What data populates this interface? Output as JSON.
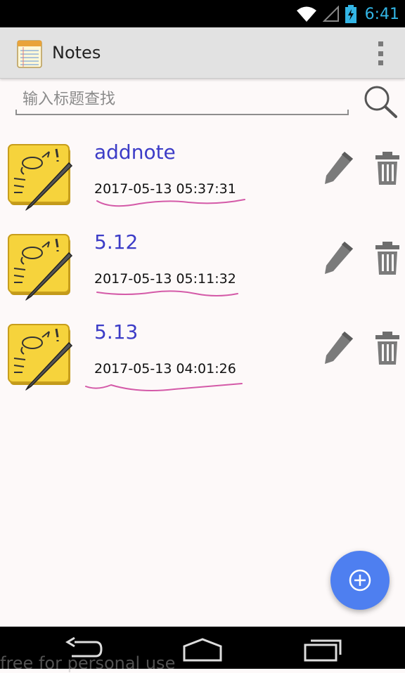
{
  "status_bar": {
    "time": "6:41",
    "icons": [
      "wifi-icon",
      "signal-icon",
      "battery-charging-icon"
    ]
  },
  "action_bar": {
    "title": "Notes",
    "app_icon": "notepad-icon",
    "overflow_icon": "overflow-menu-icon"
  },
  "search": {
    "placeholder": "输入标题查找",
    "value": "",
    "icon": "search-icon"
  },
  "notes": [
    {
      "title": "addnote",
      "date": "2017-05-13 05:37:31"
    },
    {
      "title": "5.12",
      "date": "2017-05-13 05:11:32"
    },
    {
      "title": "5.13",
      "date": "2017-05-13 04:01:26"
    }
  ],
  "note_icons": {
    "note": "sticky-note-pen-icon",
    "edit": "pencil-icon",
    "delete": "trash-icon"
  },
  "fab": {
    "icon": "add-circle-icon"
  },
  "nav_bar": {
    "icons": [
      "back-icon",
      "home-icon",
      "recents-icon"
    ]
  },
  "watermark": "free for personal use",
  "colors": {
    "accent": "#33b5e5",
    "title_blue": "#3c3cc7",
    "fab": "#4e7ff0",
    "underline_pink": "#d45aa8"
  }
}
